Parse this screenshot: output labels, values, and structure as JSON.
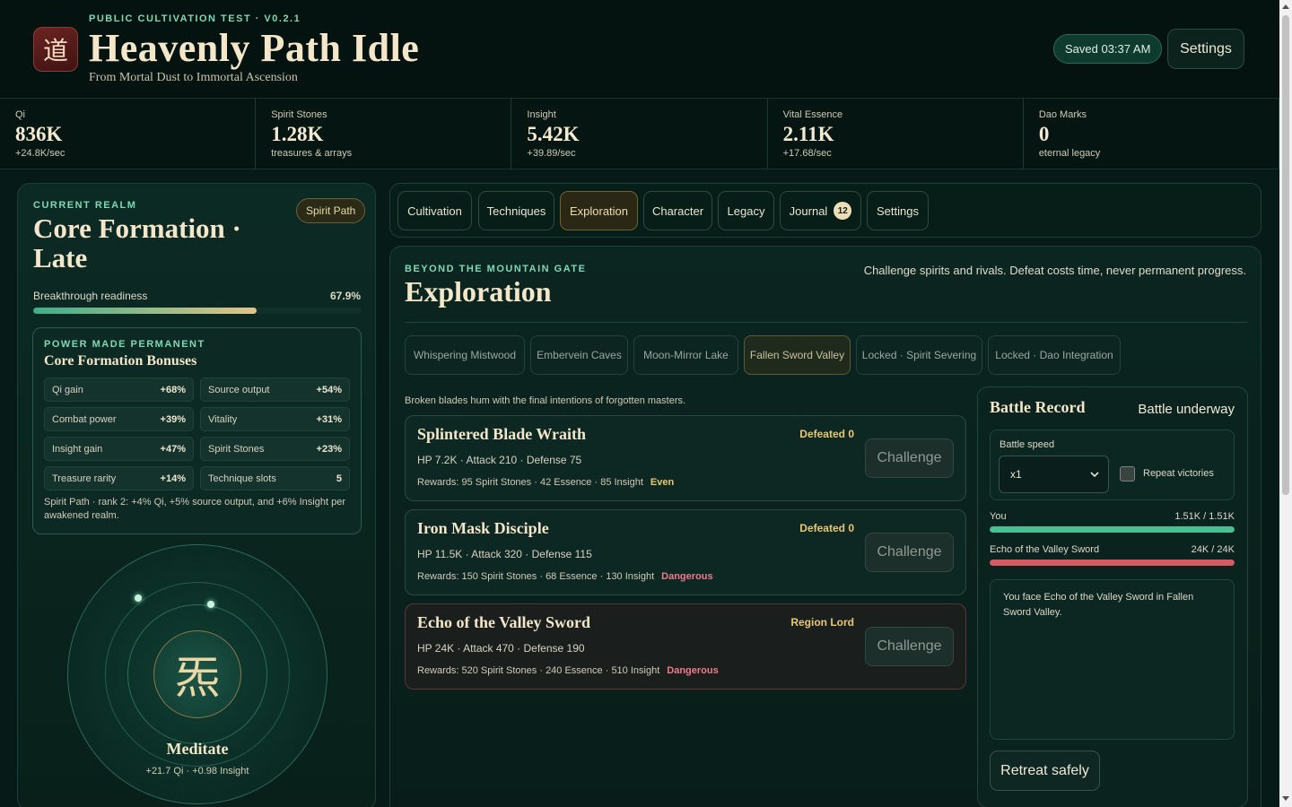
{
  "header": {
    "logo_glyph": "道",
    "build": "PUBLIC CULTIVATION TEST · V0.2.1",
    "title": "Heavenly Path Idle",
    "subtitle": "From Mortal Dust to Immortal Ascension",
    "saved": "Saved 03:37 AM",
    "settings": "Settings"
  },
  "resources": [
    {
      "label": "Qi",
      "value": "836K",
      "sub": "+24.8K/sec"
    },
    {
      "label": "Spirit Stones",
      "value": "1.28K",
      "sub": "treasures & arrays"
    },
    {
      "label": "Insight",
      "value": "5.42K",
      "sub": "+39.89/sec"
    },
    {
      "label": "Vital Essence",
      "value": "2.11K",
      "sub": "+17.68/sec"
    },
    {
      "label": "Dao Marks",
      "value": "0",
      "sub": "eternal legacy"
    }
  ],
  "realm": {
    "kicker": "CURRENT REALM",
    "path_badge": "Spirit Path",
    "name": "Core Formation · Late",
    "readiness_label": "Breakthrough readiness",
    "readiness_value": "67.9%",
    "readiness_fraction": 0.679
  },
  "bonuses": {
    "kicker": "POWER MADE PERMANENT",
    "title": "Core Formation Bonuses",
    "items": [
      {
        "label": "Qi gain",
        "value": "+68%"
      },
      {
        "label": "Source output",
        "value": "+54%"
      },
      {
        "label": "Combat power",
        "value": "+39%"
      },
      {
        "label": "Vitality",
        "value": "+31%"
      },
      {
        "label": "Insight gain",
        "value": "+47%"
      },
      {
        "label": "Spirit Stones",
        "value": "+23%"
      },
      {
        "label": "Treasure rarity",
        "value": "+14%"
      },
      {
        "label": "Technique slots",
        "value": "5"
      }
    ],
    "note": "Spirit Path · rank 2: +4% Qi, +5% source output, and +6% Insight per awakened realm."
  },
  "meditate": {
    "glyph": "炁",
    "label": "Meditate",
    "sub": "+21.7 Qi · +0.98 Insight"
  },
  "tabs": [
    {
      "label": "Cultivation"
    },
    {
      "label": "Techniques"
    },
    {
      "label": "Exploration",
      "active": true
    },
    {
      "label": "Character"
    },
    {
      "label": "Legacy"
    },
    {
      "label": "Journal",
      "badge": "12"
    },
    {
      "label": "Settings"
    }
  ],
  "exploration": {
    "kicker": "BEYOND THE MOUNTAIN GATE",
    "title": "Exploration",
    "description": "Challenge spirits and rivals. Defeat costs time, never permanent progress.",
    "regions": [
      "Whispering Mistwood",
      "Embervein Caves",
      "Moon-Mirror Lake",
      "Fallen Sword Valley",
      "Locked · Spirit Severing",
      "Locked · Dao Integration"
    ],
    "selected_region": "Fallen Sword Valley",
    "flavor": "Broken blades hum with the final intentions of forgotten masters.",
    "enemies": [
      {
        "name": "Splintered Blade Wraith",
        "stats": "HP 7.2K · Attack 210 · Defense 75",
        "rewards": "Rewards: 95 Spirit Stones · 42 Essence · 85 Insight",
        "danger": "Even",
        "status": "Defeated 0",
        "button": "Challenge"
      },
      {
        "name": "Iron Mask Disciple",
        "stats": "HP 11.5K · Attack 320 · Defense 115",
        "rewards": "Rewards: 150 Spirit Stones · 68 Essence · 130 Insight",
        "danger": "Dangerous",
        "status": "Defeated 0",
        "button": "Challenge"
      },
      {
        "name": "Echo of the Valley Sword",
        "stats": "HP 24K · Attack 470 · Defense 190",
        "rewards": "Rewards: 520 Spirit Stones · 240 Essence · 510 Insight",
        "danger": "Dangerous",
        "status": "Region Lord",
        "button": "Challenge"
      }
    ]
  },
  "battle": {
    "title": "Battle Record",
    "status": "Battle underway",
    "speed_label": "Battle speed",
    "speed_value": "x1",
    "repeat_label": "Repeat victories",
    "you_label": "You",
    "you_hp": "1.51K / 1.51K",
    "you_fraction": 1.0,
    "enemy_label": "Echo of the Valley Sword",
    "enemy_hp": "24K / 24K",
    "enemy_fraction": 1.0,
    "log": "You face Echo of the Valley Sword in Fallen Sword Valley.",
    "retreat": "Retreat safely"
  },
  "colors": {
    "accent": "#7fd8b4",
    "gold": "#e8c874",
    "danger": "#f07a8a",
    "you_bar": "#49c093",
    "enemy_bar": "#d45a63"
  }
}
